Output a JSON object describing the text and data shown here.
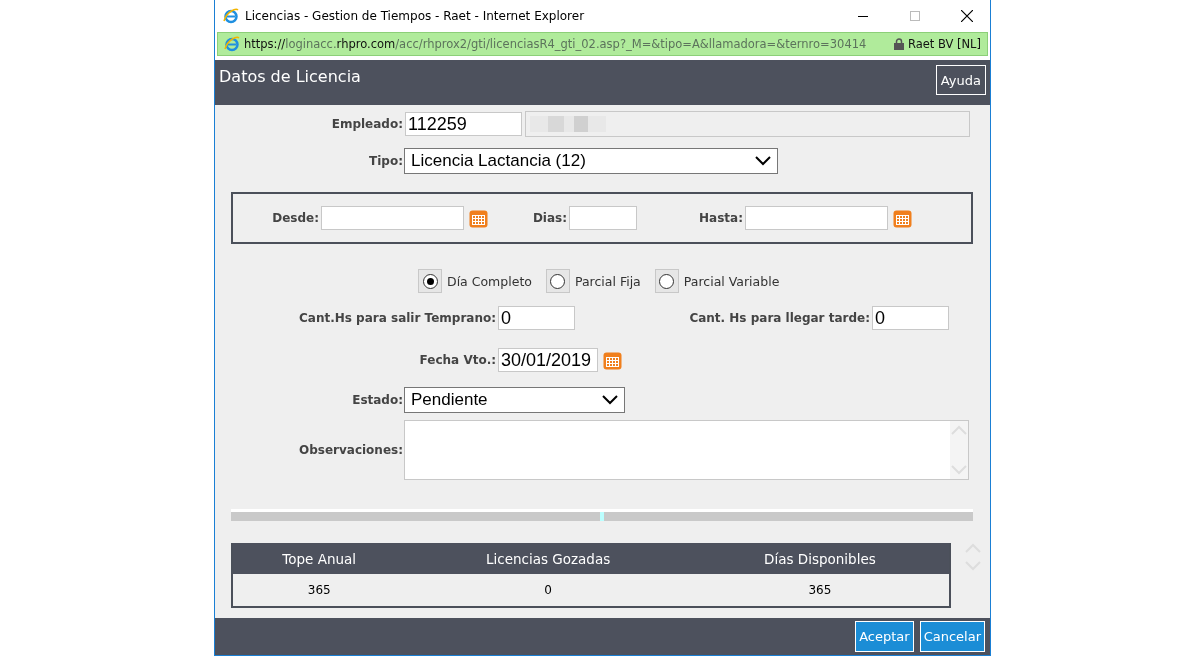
{
  "window": {
    "title": "Licencias - Gestion de Tiempos - Raet - Internet Explorer"
  },
  "address_bar": {
    "url": [
      {
        "text": "https://",
        "strong": true
      },
      {
        "text": "loginacc.",
        "strong": false
      },
      {
        "text": "rhpro.com",
        "strong": true
      },
      {
        "text": "/acc/rhprox2/gti/licenciasR4_gti_02.asp?_M=&tipo=A&llamadora=&ternro=30414",
        "strong": false
      }
    ],
    "certificate": "Raet BV [NL]"
  },
  "header": {
    "title": "Datos de Licencia",
    "help_button": "Ayuda"
  },
  "form": {
    "empleado": {
      "label": "Empleado:",
      "value": "112259"
    },
    "tipo": {
      "label": "Tipo:",
      "value": "Licencia Lactancia (12)"
    },
    "desde": {
      "label": "Desde:"
    },
    "dias": {
      "label": "Dias:"
    },
    "hasta": {
      "label": "Hasta:"
    },
    "modes": [
      {
        "label": "Día Completo",
        "selected": true
      },
      {
        "label": "Parcial Fija",
        "selected": false
      },
      {
        "label": "Parcial Variable",
        "selected": false
      }
    ],
    "temprano": {
      "label": "Cant.Hs para salir Temprano:",
      "value": "0"
    },
    "tarde": {
      "label": "Cant. Hs para llegar tarde:",
      "value": "0"
    },
    "fecha_vto": {
      "label": "Fecha Vto.:",
      "value": "30/01/2019"
    },
    "estado": {
      "label": "Estado:",
      "value": "Pendiente"
    },
    "observaciones": {
      "label": "Observaciones:"
    }
  },
  "table": {
    "columns": [
      "Tope Anual",
      "Licencias Gozadas",
      "Días Disponibles"
    ],
    "rows": [
      [
        "365",
        "0",
        "365"
      ]
    ]
  },
  "footer": {
    "buttons": [
      "Aceptar",
      "Cancelar"
    ]
  }
}
